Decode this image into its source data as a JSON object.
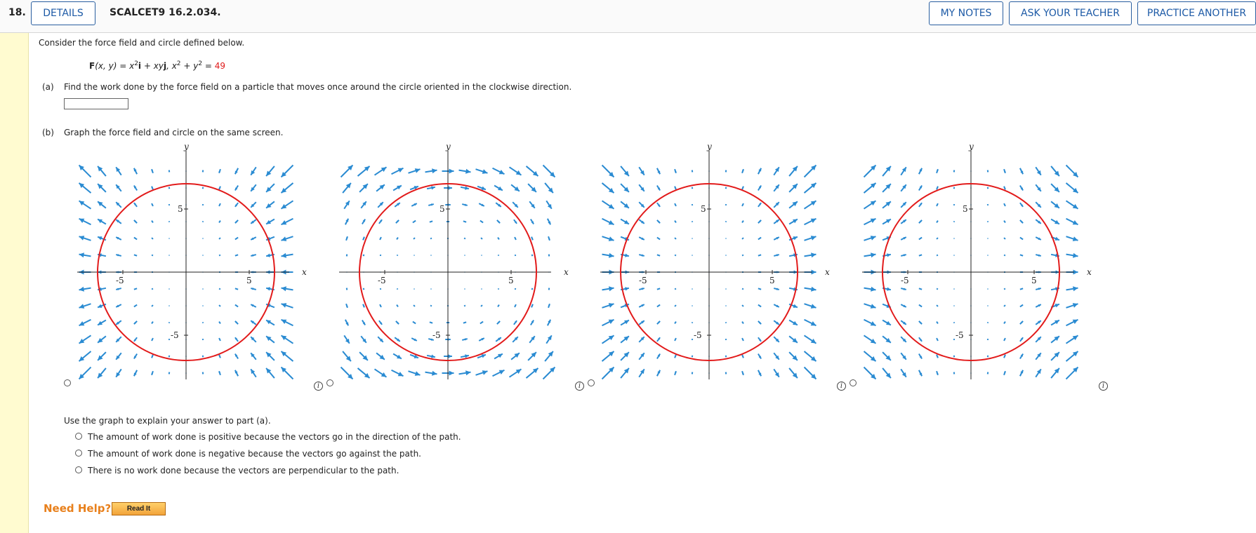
{
  "header": {
    "question_number": "18.",
    "details_label": "DETAILS",
    "question_code": "SCALCET9 16.2.034.",
    "my_notes_label": "MY NOTES",
    "ask_teacher_label": "ASK YOUR TEACHER",
    "practice_label": "PRACTICE ANOTHER"
  },
  "problem": {
    "intro": "Consider the force field and circle defined below.",
    "formula": {
      "F": "F",
      "args": "(x, y) = x",
      "sup1": "2",
      "i": "i",
      "mid": " + xy",
      "j": "j",
      "circle_lhs": ",   x",
      "sup2": "2",
      "plus": " + y",
      "sup3": "2",
      "eq": " = ",
      "radius_sq": "49"
    },
    "part_a_label": "(a)",
    "part_a_text": "Find the work done by the force field on a particle that moves once around the circle oriented in the clockwise direction.",
    "answer_value": "",
    "part_b_label": "(b)",
    "part_b_text": "Graph the force field and circle on the same screen."
  },
  "graphs": {
    "x_label": "x",
    "y_label": "y",
    "tick_pos": "5",
    "tick_neg": "-5",
    "info_glyph": "i",
    "options": [
      {
        "field": "-x2-xy"
      },
      {
        "field": "y2-xy"
      },
      {
        "field": "x2+xy"
      },
      {
        "field": "x2-xy"
      }
    ]
  },
  "explain": {
    "prompt": "Use the graph to explain your answer to part (a).",
    "choices": [
      "The amount of work done is positive because the vectors go in the direction of the path.",
      "The amount of work done is negative because the vectors go against the path.",
      "There is no work done because the vectors are perpendicular to the path."
    ]
  },
  "help": {
    "need_help": "Need Help?",
    "read_it": "Read It"
  },
  "colors": {
    "arrow": "#2a8bd2",
    "circle": "#e21b1b",
    "button_text": "#1d5aa6",
    "help_orange": "#e8801c",
    "left_band": "#fffbd0"
  }
}
